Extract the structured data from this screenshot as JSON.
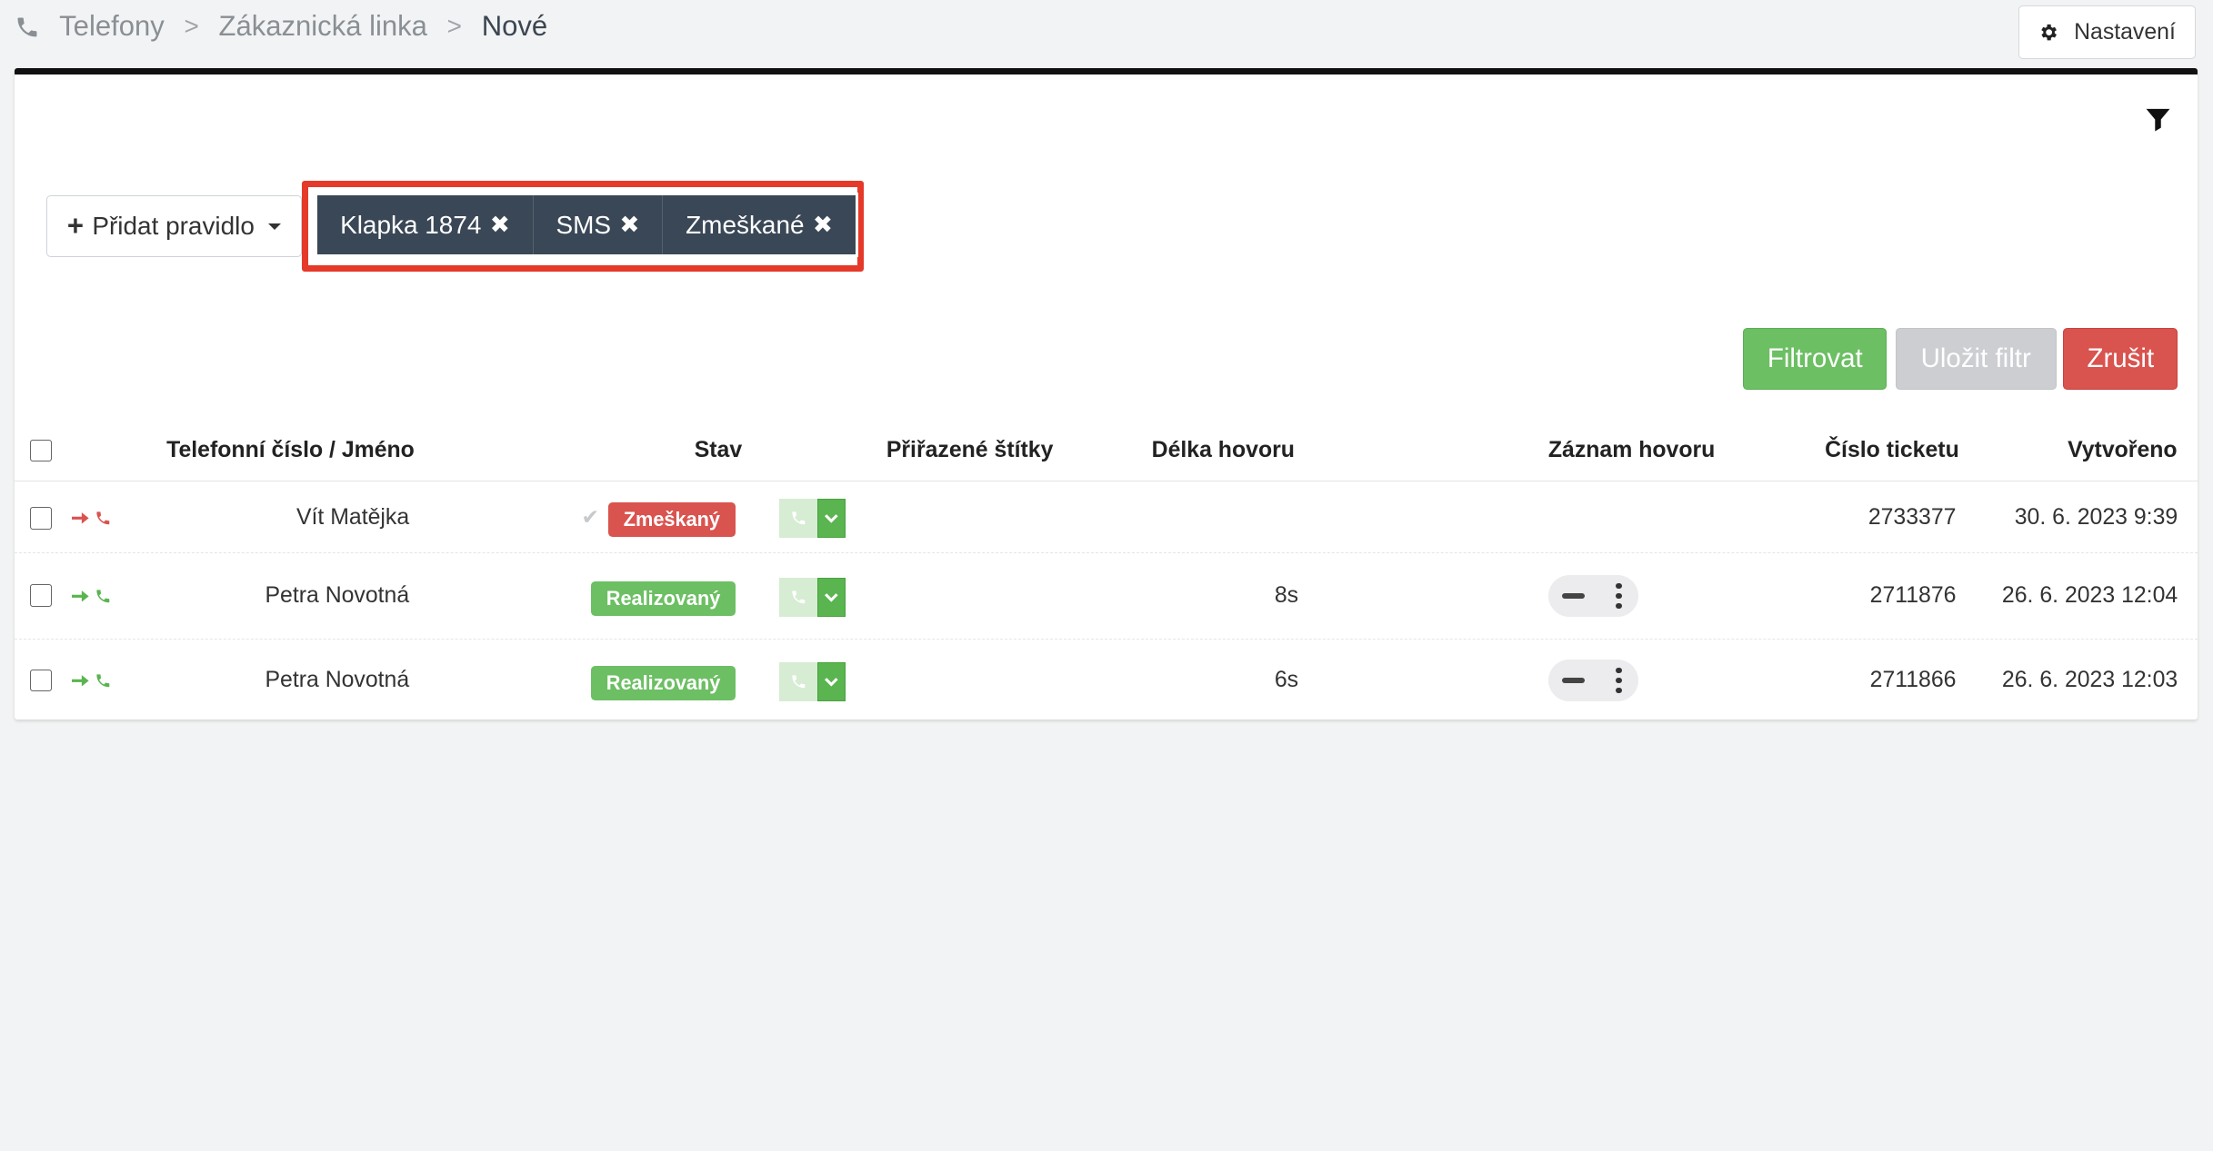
{
  "breadcrumb": {
    "items": [
      "Telefony",
      "Zákaznická linka",
      "Nové"
    ],
    "separator": ">"
  },
  "header": {
    "settings_label": "Nastavení"
  },
  "filters": {
    "add_rule_label": "Přidat pravidlo",
    "chips": [
      {
        "label": "Klapka 1874"
      },
      {
        "label": "SMS"
      },
      {
        "label": "Zmeškané"
      }
    ],
    "filter_button": "Filtrovat",
    "save_button": "Uložit filtr",
    "cancel_button": "Zrušit"
  },
  "table": {
    "columns": {
      "phone": "Telefonní číslo / Jméno",
      "status": "Stav",
      "tags": "Přiřazené štítky",
      "duration": "Délka hovoru",
      "recording": "Záznam hovoru",
      "ticket": "Číslo ticketu",
      "created": "Vytvořeno"
    },
    "rows": [
      {
        "name": "Vít Matějka",
        "status": "Zmeškaný",
        "status_type": "missed",
        "duration": "",
        "ticket": "2733377",
        "created": "30. 6. 2023 9:39",
        "has_recording": false
      },
      {
        "name": "Petra Novotná",
        "status": "Realizovaný",
        "status_type": "done",
        "duration": "8s",
        "ticket": "2711876",
        "created": "26. 6. 2023 12:04",
        "has_recording": true
      },
      {
        "name": "Petra Novotná",
        "status": "Realizovaný",
        "status_type": "done",
        "duration": "6s",
        "ticket": "2711866",
        "created": "26. 6. 2023 12:03",
        "has_recording": true
      }
    ]
  },
  "colors": {
    "accent_dark": "#3a4756",
    "highlight": "#e5392a",
    "success": "#6cbf63",
    "danger": "#d9534f",
    "muted": "#ccced1"
  },
  "icons": {
    "breadcrumb": "phone-icon",
    "settings": "gear-icon",
    "filter": "funnel-icon",
    "chip_remove": "close-icon",
    "direction": "arrow-right-icon",
    "call": "phone-icon",
    "dropdown": "chevron-down-icon"
  }
}
